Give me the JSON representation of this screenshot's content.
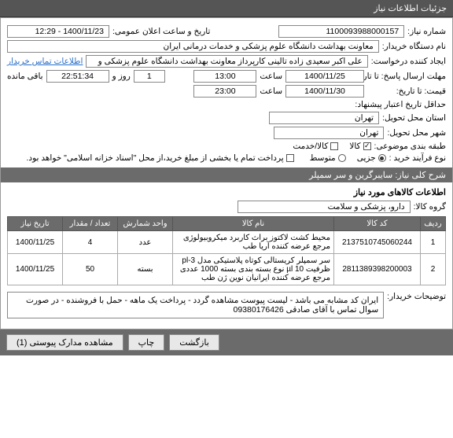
{
  "tab_title": "جزئیات اطلاعات نیاز",
  "fields": {
    "need_no_lbl": "شماره نیاز:",
    "need_no": "1100093988000157",
    "announce_lbl": "تاریخ و ساعت اعلان عمومی:",
    "announce_val": "1400/11/23 - 12:29",
    "buyer_lbl": "نام دستگاه خریدار:",
    "buyer_val": "معاونت بهداشت دانشگاه علوم پزشکی و خدمات درمانی ایران",
    "creator_lbl": "ایجاد کننده درخواست:",
    "creator_val": "علی اکبر سعیدی زاده تالینی کارپرداز معاونت بهداشت دانشگاه علوم پزشکی و",
    "contact_link": "اطلاعات تماس خریدار",
    "deadline_lbl": "حداقل تاریخ اعتبار پیشنهاد:",
    "reply_deadline_lbl": "مهلت ارسال پاسخ: تا تاریخ:",
    "reply_date": "1400/11/25",
    "reply_time": "13:00",
    "saat": "ساعت",
    "remain_days": "1",
    "roz_va": "روز و",
    "remain_time": "22:51:34",
    "remain_suffix": "باقی مانده",
    "quote_until_lbl": "قیمت: تا تاریخ:",
    "quote_date": "1400/11/30",
    "quote_time": "23:00",
    "province_lbl": "استان محل تحویل:",
    "province": "تهران",
    "city_lbl": "شهر محل تحویل:",
    "city": "تهران",
    "class_lbl": "طبقه بندی موضوعی:",
    "class_goods": "کالا",
    "class_service": "کالا/خدمت",
    "process_lbl": "نوع فرآیند خرید :",
    "proc_small": "جزیی",
    "proc_medium": "متوسط",
    "pay_note": "پرداخت تمام یا بخشی از مبلغ خرید،از محل \"اسناد خزانه اسلامی\" خواهد بود."
  },
  "desc": {
    "title_lbl": "شرح کلی نیاز:",
    "title_val": "سایبرگرین و سر سمپلر"
  },
  "goods": {
    "header": "اطلاعات کالاهای مورد نیاز",
    "group_lbl": "گروه کالا:",
    "group_val": "دارو، پزشکی و سلامت"
  },
  "table": {
    "cols": [
      "ردیف",
      "کد کالا",
      "نام کالا",
      "واحد شمارش",
      "تعداد / مقدار",
      "تاریخ نیاز"
    ],
    "rows": [
      {
        "idx": "1",
        "code": "2137510745060244",
        "name": "محیط کشت لاکتوز براث کاربرد میکروبیولوژی مرجع عرضه کننده آریا طب",
        "unit": "عدد",
        "qty": "4",
        "date": "1400/11/25"
      },
      {
        "idx": "2",
        "code": "2811389398200003",
        "name": "سر سمپلر کریستالی کوتاه پلاستیکی مدل 3-pl ظرفیت 10 µl نوع بسته بندی بسته 1000 عددی مرجع عرضه کننده ایرانیان نوین ژن طب",
        "unit": "بسته",
        "qty": "50",
        "date": "1400/11/25"
      }
    ]
  },
  "buyer_notes": {
    "lbl": "توضیحات خریدار:",
    "val": "ایران کد مشابه می باشد - لیست پیوست مشاهده گردد - پرداخت یک ماهه - حمل با فروشنده - در صورت سوال تماس با آقای صادقی 09380176426"
  },
  "buttons": {
    "view_docs": "مشاهده مدارک پیوستی (1)",
    "print": "چاپ",
    "back": "بازگشت"
  }
}
